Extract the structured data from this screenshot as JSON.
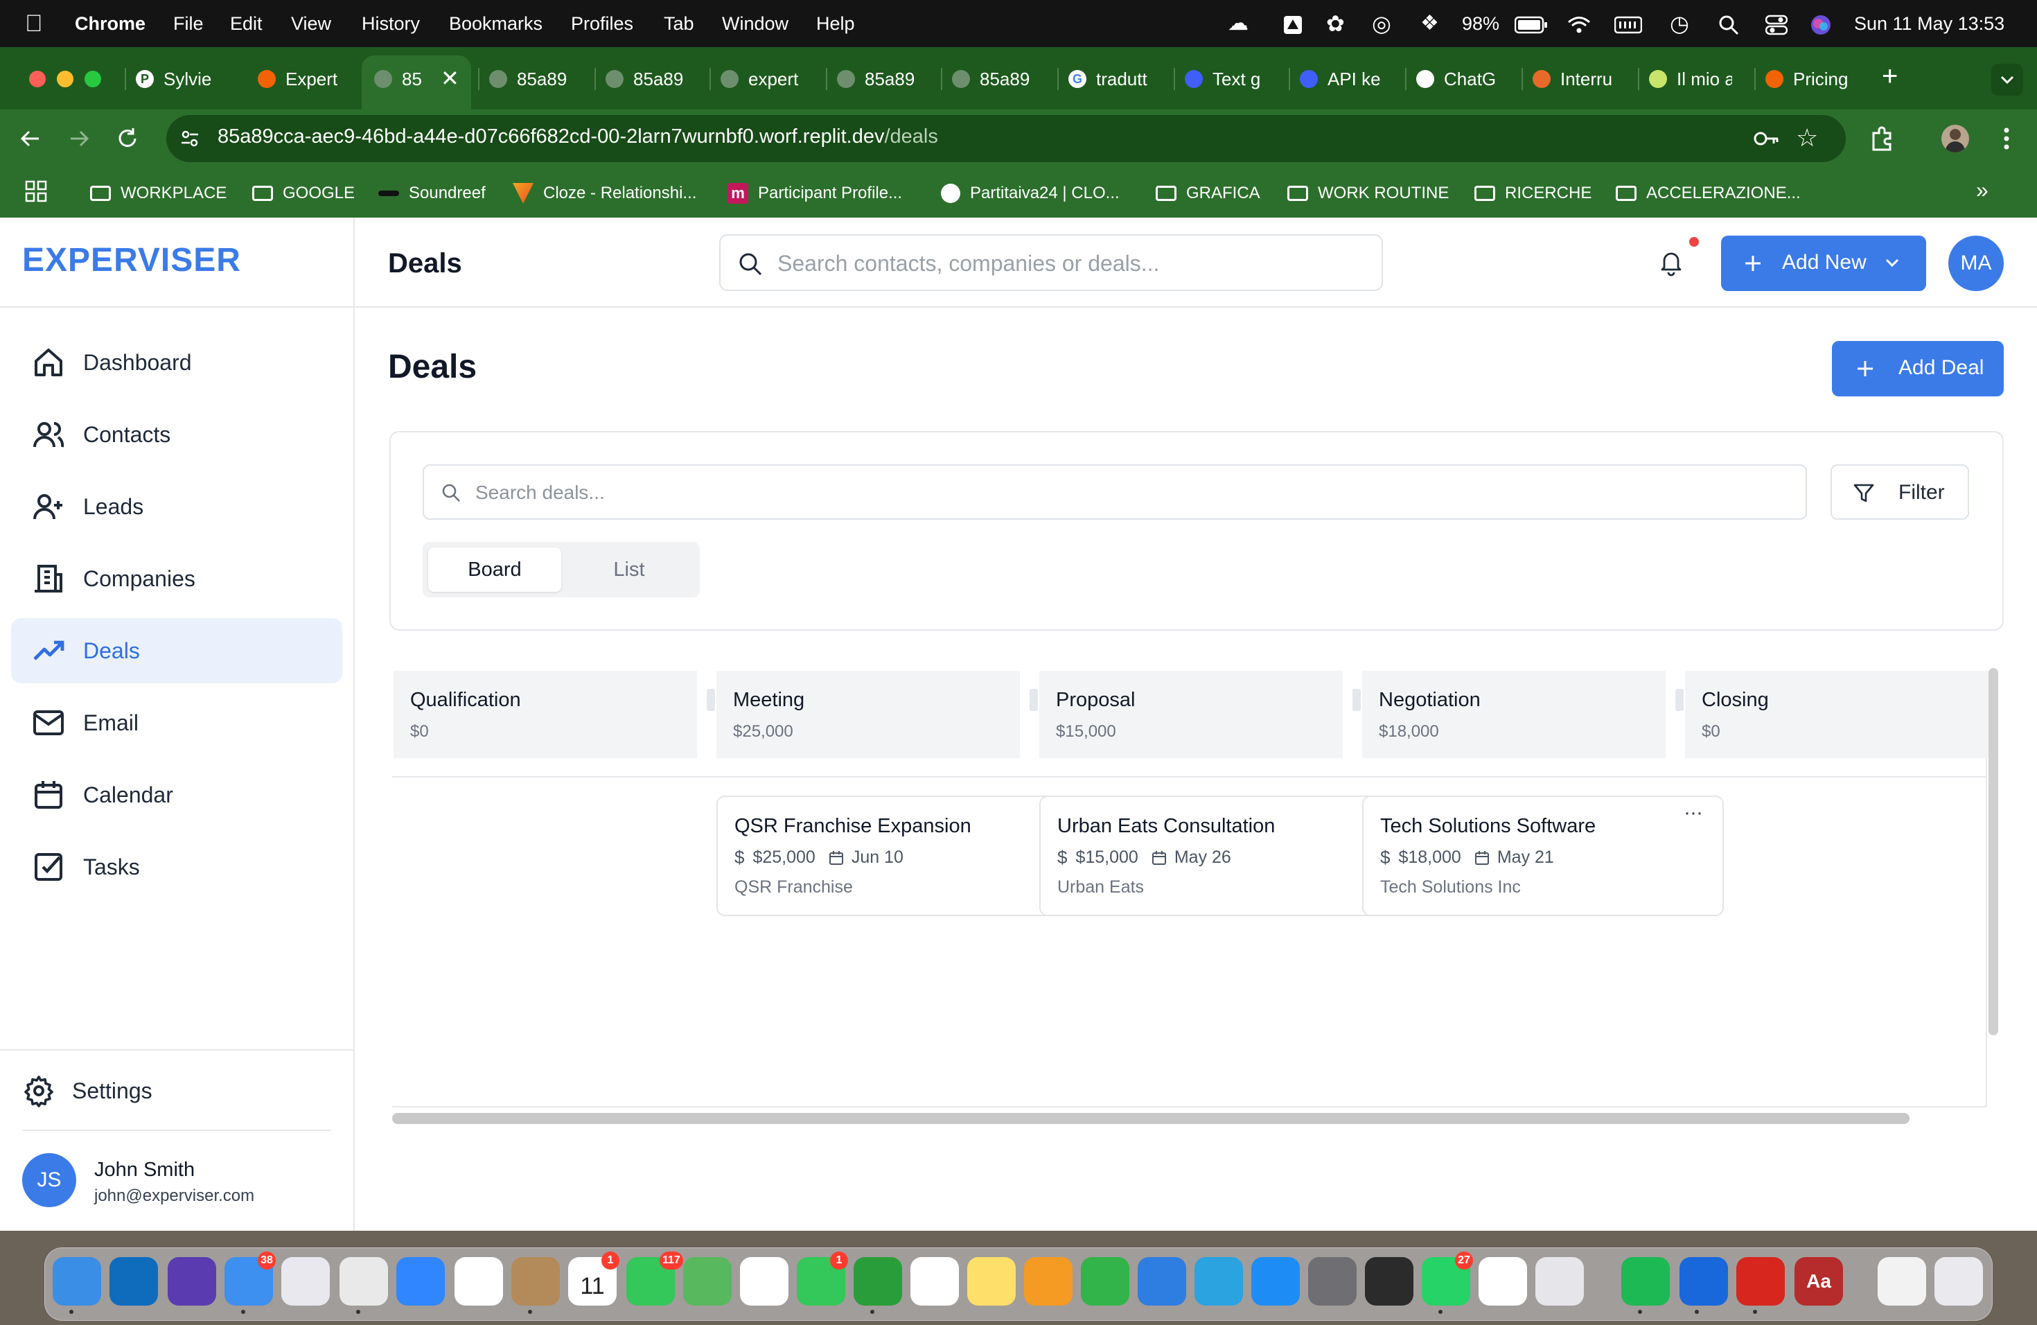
{
  "menubar": {
    "app_name": "Chrome",
    "items": [
      "File",
      "Edit",
      "View",
      "History",
      "Bookmarks",
      "Profiles",
      "Tab",
      "Window",
      "Help"
    ],
    "battery": "98%",
    "datetime": "Sun 11 May  13:53"
  },
  "browser": {
    "tabs": [
      {
        "label": "Sylvie",
        "icon": "p-icon"
      },
      {
        "label": "Expert",
        "icon": "replit-icon"
      },
      {
        "label": "85",
        "icon": "globe-icon"
      },
      {
        "label": "85a89",
        "icon": "globe-icon"
      },
      {
        "label": "85a89",
        "icon": "globe-icon"
      },
      {
        "label": "expert",
        "icon": "globe-icon"
      },
      {
        "label": "85a89",
        "icon": "globe-icon"
      },
      {
        "label": "85a89",
        "icon": "globe-icon"
      },
      {
        "label": "tradutt",
        "icon": "google-icon"
      },
      {
        "label": "Text g",
        "icon": "ai-icon"
      },
      {
        "label": "API ke",
        "icon": "ai-icon"
      },
      {
        "label": "ChatG",
        "icon": "openai-icon"
      },
      {
        "label": "Interru",
        "icon": "avatar-icon"
      },
      {
        "label": "Il mio a",
        "icon": "app-icon"
      },
      {
        "label": "Pricing",
        "icon": "replit-icon"
      }
    ],
    "url_host": "85a89cca-aec9-46bd-a44e-d07c66f682cd-00-2larn7wurnbf0.worf.replit.dev",
    "url_path": "/deals",
    "bookmarks": [
      {
        "label": "WORKPLACE",
        "type": "folder"
      },
      {
        "label": "GOOGLE",
        "type": "folder"
      },
      {
        "label": "Soundreef",
        "type": "site"
      },
      {
        "label": "Cloze - Relationshi...",
        "type": "site"
      },
      {
        "label": "Participant Profile...",
        "type": "site"
      },
      {
        "label": "Partitaiva24 | CLO...",
        "type": "site"
      },
      {
        "label": "GRAFICA",
        "type": "folder"
      },
      {
        "label": "WORK ROUTINE",
        "type": "folder"
      },
      {
        "label": "RICERCHE",
        "type": "folder"
      },
      {
        "label": "ACCELERAZIONE...",
        "type": "folder"
      }
    ]
  },
  "app": {
    "brand": "EXPERVISER",
    "header_title": "Deals",
    "search_placeholder": "Search contacts, companies or deals...",
    "add_new_label": "Add New",
    "user_initials": "MA",
    "nav": [
      {
        "label": "Dashboard",
        "icon": "home-icon"
      },
      {
        "label": "Contacts",
        "icon": "users-icon"
      },
      {
        "label": "Leads",
        "icon": "user-plus-icon"
      },
      {
        "label": "Companies",
        "icon": "building-icon"
      },
      {
        "label": "Deals",
        "icon": "trending-up-icon",
        "active": true
      },
      {
        "label": "Email",
        "icon": "mail-icon"
      },
      {
        "label": "Calendar",
        "icon": "calendar-icon"
      },
      {
        "label": "Tasks",
        "icon": "check-square-icon"
      }
    ],
    "settings_label": "Settings",
    "user": {
      "initials": "JS",
      "name": "John Smith",
      "email": "john@experviser.com"
    }
  },
  "deals": {
    "title": "Deals",
    "add_deal_label": "Add Deal",
    "search_placeholder": "Search deals...",
    "filter_label": "Filter",
    "views": [
      "Board",
      "List"
    ],
    "active_view": "Board",
    "columns": [
      {
        "name": "Qualification",
        "total": "$0"
      },
      {
        "name": "Meeting",
        "total": "$25,000"
      },
      {
        "name": "Proposal",
        "total": "$15,000"
      },
      {
        "name": "Negotiation",
        "total": "$18,000"
      },
      {
        "name": "Closing",
        "total": "$0"
      }
    ],
    "cards": [
      {
        "title": "QSR Franchise Expansion",
        "amount": "$25,000",
        "date": "Jun 10",
        "company": "QSR Franchise",
        "stage": "Meeting"
      },
      {
        "title": "Urban Eats Consultation",
        "amount": "$15,000",
        "date": "May 26",
        "company": "Urban Eats",
        "stage": "Proposal"
      },
      {
        "title": "Tech Solutions Software",
        "amount": "$18,000",
        "date": "May 21",
        "company": "Tech Solutions Inc",
        "stage": "Negotiation"
      }
    ]
  },
  "dock": {
    "apps": [
      {
        "name": "finder-icon",
        "color": "#3a8ee6"
      },
      {
        "name": "outlook-icon",
        "color": "#0f6cbd",
        "badge": ""
      },
      {
        "name": "siri-icon",
        "color": "#5b3bb0"
      },
      {
        "name": "mail-icon",
        "color": "#3d8ff0",
        "badge": "38"
      },
      {
        "name": "launchpad-icon",
        "color": "#e8e8ee"
      },
      {
        "name": "chrome-icon",
        "color": "#e9e9e9"
      },
      {
        "name": "safari-icon",
        "color": "#2f86ff"
      },
      {
        "name": "opera-icon",
        "color": "#ffffff"
      },
      {
        "name": "contacts-icon",
        "color": "#b38a5a"
      },
      {
        "name": "calendar-icon",
        "color": "#ffffff",
        "badge": "1",
        "label": "11"
      },
      {
        "name": "messages-icon",
        "color": "#34c759",
        "badge": "117"
      },
      {
        "name": "maps-icon",
        "color": "#58b85e"
      },
      {
        "name": "photos-icon",
        "color": "#ffffff"
      },
      {
        "name": "facetime-icon",
        "color": "#34c759",
        "badge": "1"
      },
      {
        "name": "chat-icon",
        "color": "#2a9d3b"
      },
      {
        "name": "evernote-icon",
        "color": "#ffffff"
      },
      {
        "name": "notes-icon",
        "color": "#fddf6a"
      },
      {
        "name": "pages-icon",
        "color": "#f59a23"
      },
      {
        "name": "numbers-icon",
        "color": "#32b44a"
      },
      {
        "name": "keynote-icon",
        "color": "#2e7de0"
      },
      {
        "name": "telegram-icon",
        "color": "#2aa3e0"
      },
      {
        "name": "appstore-icon",
        "color": "#1d8df5"
      },
      {
        "name": "system-settings-icon",
        "color": "#6e6e73"
      },
      {
        "name": "phone-icon",
        "color": "#2b2b2b"
      },
      {
        "name": "whatsapp-icon",
        "color": "#25d366",
        "badge": "27"
      },
      {
        "name": "openai-icon",
        "color": "#ffffff"
      },
      {
        "name": "iphone-mirroring-icon",
        "color": "#e5e5ea"
      },
      {
        "name": "spotify-icon",
        "color": "#1db954"
      },
      {
        "name": "trello-icon",
        "color": "#1868db"
      },
      {
        "name": "acrobat-icon",
        "color": "#d7261e"
      },
      {
        "name": "dictionary-icon",
        "color": "#b62b2b",
        "label": "Aa"
      },
      {
        "name": "files-icon",
        "color": "#f2f2f2"
      },
      {
        "name": "trash-icon",
        "color": "#e9e9ee"
      }
    ]
  }
}
